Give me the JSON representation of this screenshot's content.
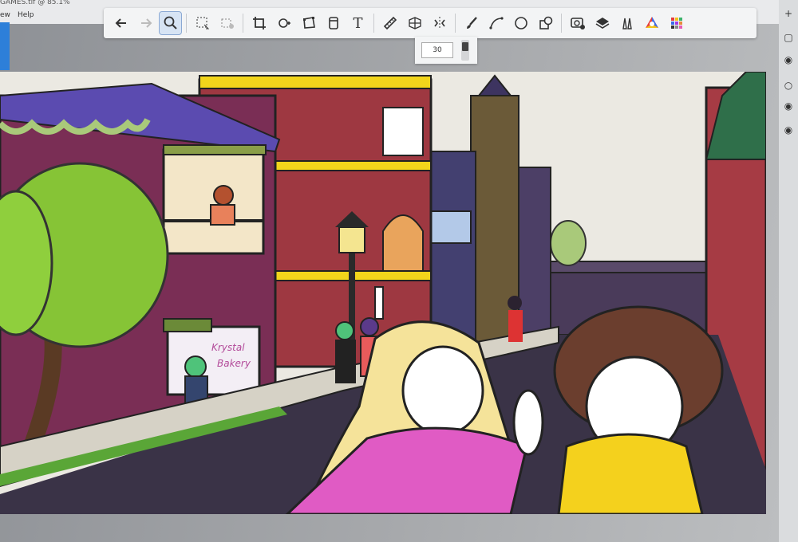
{
  "app": {
    "title": "GAMES.tif @ 85.1%",
    "menu": [
      "ew",
      "Help"
    ]
  },
  "toolbar": {
    "tools": [
      {
        "name": "undo-icon",
        "active": false
      },
      {
        "name": "redo-icon",
        "active": false
      },
      {
        "name": "zoom-icon",
        "active": true
      },
      {
        "name": "select-rect-icon",
        "active": false
      },
      {
        "name": "clear-selection-icon",
        "active": false
      },
      {
        "name": "crop-icon",
        "active": false
      },
      {
        "name": "lasso-icon",
        "active": false
      },
      {
        "name": "transform-icon",
        "active": false
      },
      {
        "name": "fill-icon",
        "active": false
      },
      {
        "name": "text-icon",
        "active": false
      },
      {
        "name": "ruler-icon",
        "active": false
      },
      {
        "name": "perspective-icon",
        "active": false
      },
      {
        "name": "symmetry-icon",
        "active": false
      },
      {
        "name": "brush-icon",
        "active": false
      },
      {
        "name": "curve-icon",
        "active": false
      },
      {
        "name": "ellipse-icon",
        "active": false
      },
      {
        "name": "shapes-icon",
        "active": false
      },
      {
        "name": "image-import-icon",
        "active": false
      },
      {
        "name": "layers-icon",
        "active": false
      },
      {
        "name": "brushes-icon",
        "active": false
      },
      {
        "name": "color-wheel-icon",
        "active": false
      },
      {
        "name": "swatches-icon",
        "active": false
      }
    ],
    "text_tool_glyph": "T"
  },
  "brush_size": {
    "value": "30",
    "slider_fraction": 0.2
  },
  "canvas": {
    "bakery_sign": [
      "Krystal",
      "Bakery"
    ],
    "colors": {
      "sky": "#ebe9e2",
      "brick": "#a63b44",
      "purple_building": "#7a2e55",
      "tree": "#86c436",
      "yellow_trim": "#f2d51b",
      "road": "#3a3347",
      "pink_shirt": "#e05bc4",
      "yellow_shirt": "#f4d11d"
    }
  }
}
